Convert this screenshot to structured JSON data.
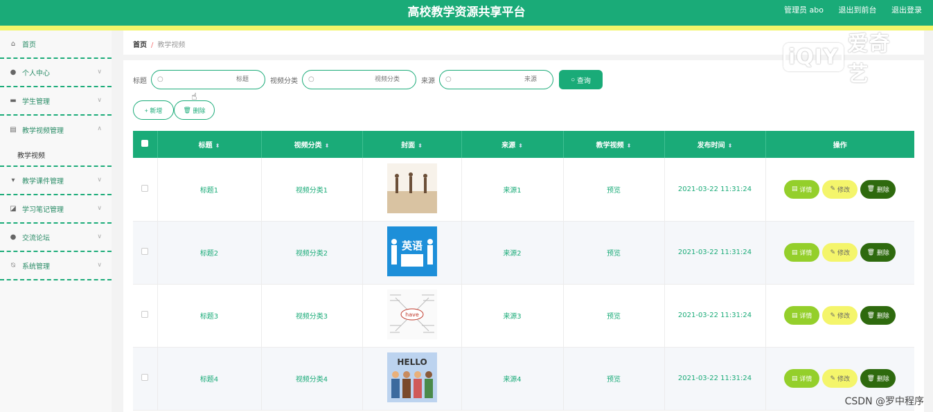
{
  "header": {
    "title": "高校教学资源共享平台",
    "admin": "管理员 abo",
    "to_front": "退出到前台",
    "logout": "退出登录"
  },
  "sidebar": {
    "items": [
      {
        "label": "首页",
        "icon": "home-icon"
      },
      {
        "label": "个人中心",
        "icon": "user-icon"
      },
      {
        "label": "学生管理",
        "icon": "monitor-icon"
      },
      {
        "label": "教学视频管理",
        "icon": "clipboard-icon"
      },
      {
        "label": "教学课件管理",
        "icon": "pin-icon"
      },
      {
        "label": "学习笔记管理",
        "icon": "chart-icon"
      },
      {
        "label": "交流论坛",
        "icon": "location-icon"
      },
      {
        "label": "系统管理",
        "icon": "bell-off-icon"
      }
    ],
    "sub_item": "教学视频"
  },
  "breadcrumb": {
    "home": "首页",
    "sep": "/",
    "current": "教学视频"
  },
  "search": {
    "title_label": "标题",
    "title_placeholder": "标题",
    "category_label": "视频分类",
    "category_placeholder": "视频分类",
    "source_label": "来源",
    "source_placeholder": "来源",
    "query": "查询"
  },
  "actions": {
    "add": "+ 新增",
    "delete": "删除"
  },
  "table": {
    "headers": [
      "标题",
      "视频分类",
      "封面",
      "来源",
      "教学视频",
      "发布时间",
      "操作"
    ],
    "rows": [
      {
        "title": "标题1",
        "category": "视频分类1",
        "source": "来源1",
        "video": "预览",
        "time": "2021-03-22 11:31:24"
      },
      {
        "title": "标题2",
        "category": "视频分类2",
        "source": "来源2",
        "video": "预览",
        "time": "2021-03-22 11:31:24"
      },
      {
        "title": "标题3",
        "category": "视频分类3",
        "source": "来源3",
        "video": "预览",
        "time": "2021-03-22 11:31:24"
      },
      {
        "title": "标题4",
        "category": "视频分类4",
        "source": "来源4",
        "video": "预览",
        "time": "2021-03-22 11:31:24"
      }
    ],
    "row_actions": {
      "detail": "详情",
      "edit": "修改",
      "remove": "删除"
    }
  },
  "cover_text": {
    "cover2": "英语",
    "cover3": "have",
    "cover4": "HELLO"
  },
  "watermark": "爱奇艺",
  "watermark_logo": "iQIY",
  "credit": "CSDN @罗中程序",
  "colors": {
    "primary": "#1aab78",
    "stripe": "#f2f56a",
    "detail": "#94cf2b",
    "edit": "#f4f56b",
    "remove": "#2e6a0e"
  }
}
